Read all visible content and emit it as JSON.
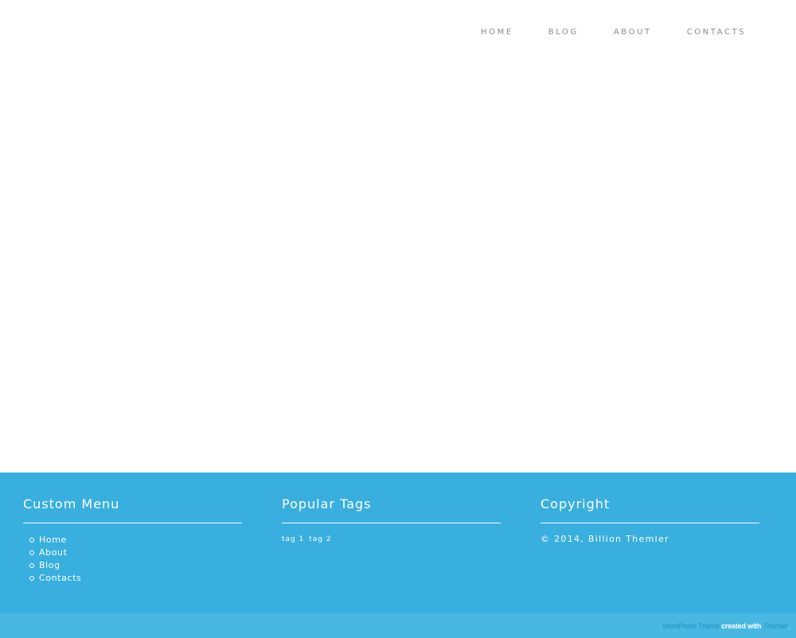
{
  "colors": {
    "footer_bg": "#38afdf",
    "bottom_bar_bg": "#48b8e3",
    "nav_text": "#8a8a8a",
    "credit_link": "#2690bd"
  },
  "nav": {
    "items": [
      {
        "label": "HOME"
      },
      {
        "label": "BLOG"
      },
      {
        "label": "ABOUT"
      },
      {
        "label": "CONTACTS"
      }
    ]
  },
  "footer": {
    "custom_menu": {
      "title": "Custom Menu",
      "items": [
        {
          "label": "Home"
        },
        {
          "label": "About"
        },
        {
          "label": "Blog"
        },
        {
          "label": "Contacts"
        }
      ]
    },
    "popular_tags": {
      "title": "Popular Tags",
      "tags": [
        {
          "label": "tag 1"
        },
        {
          "label": "tag 2"
        }
      ]
    },
    "copyright": {
      "title": "Copyright",
      "text": "© 2014, Billion Themler"
    }
  },
  "bottom_bar": {
    "link1": "WordPress Theme",
    "middle": " created with ",
    "link2": "Themler",
    "suffix": "."
  }
}
